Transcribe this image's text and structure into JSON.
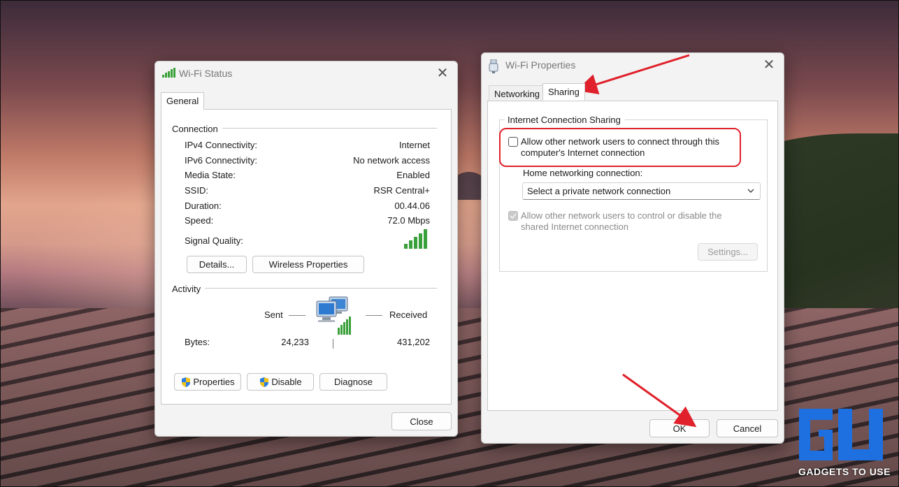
{
  "wifi_status": {
    "title": "Wi-Fi Status",
    "tab_general": "General",
    "connection": {
      "heading": "Connection",
      "rows": [
        {
          "label": "IPv4 Connectivity:",
          "value": "Internet"
        },
        {
          "label": "IPv6 Connectivity:",
          "value": "No network access"
        },
        {
          "label": "Media State:",
          "value": "Enabled"
        },
        {
          "label": "SSID:",
          "value": "RSR Central+"
        },
        {
          "label": "Duration:",
          "value": "00.44.06"
        },
        {
          "label": "Speed:",
          "value": "72.0 Mbps"
        }
      ],
      "signal_label": "Signal Quality:",
      "signal_bars": 5,
      "details_button": "Details...",
      "wireless_properties_button": "Wireless Properties"
    },
    "activity": {
      "heading": "Activity",
      "sent_label": "Sent",
      "received_label": "Received",
      "bytes_label": "Bytes:",
      "bytes_sent": "24,233",
      "bytes_received": "431,202"
    },
    "properties_button": "Properties",
    "disable_button": "Disable",
    "diagnose_button": "Diagnose",
    "close_button": "Close"
  },
  "wifi_properties": {
    "title": "Wi-Fi Properties",
    "tabs": {
      "networking": "Networking",
      "sharing": "Sharing"
    },
    "ics": {
      "heading": "Internet Connection Sharing",
      "allow_connect_line1": "Allow other network users to connect through this",
      "allow_connect_line2": "computer's Internet connection",
      "allow_connect_checked": false,
      "home_networking_label": "Home networking connection:",
      "home_networking_selected": "Select a private network connection",
      "allow_control_line1": "Allow other network users to control or disable the",
      "allow_control_line2": "shared Internet connection",
      "settings_button": "Settings..."
    },
    "ok_button": "OK",
    "cancel_button": "Cancel"
  },
  "watermark": {
    "text": "GADGETS TO USE"
  },
  "colors": {
    "annotation_red": "#e0202a",
    "signal_green": "#3aa03a",
    "logo_blue": "#1e6fe0"
  }
}
